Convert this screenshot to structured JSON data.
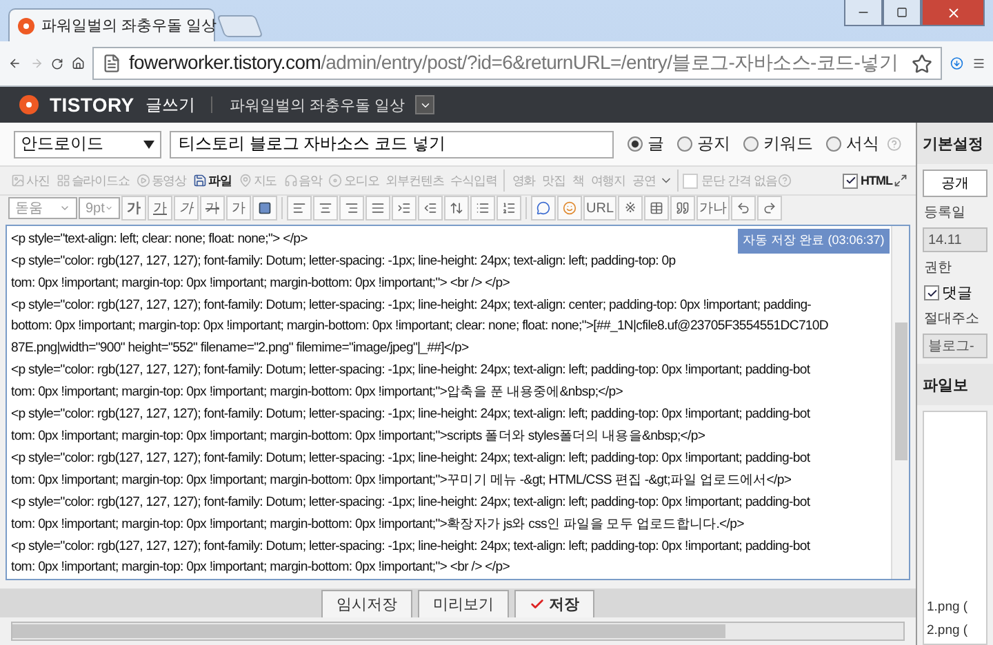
{
  "browser": {
    "tab": {
      "title": "파워일벌의 좌충우돌 일상"
    },
    "url": {
      "host": "fowerworker.tistory.com",
      "path": "/admin/entry/post/?id=6&returnURL=/entry/블로그-자바소스-코드-넣기"
    }
  },
  "header": {
    "logo": "TISTORY",
    "section": "글쓰기",
    "blog": "파워일벌의 좌충우돌 일상"
  },
  "post": {
    "category": "안드로이드",
    "title": "티스토리 블로그 자바소스 코드 넣기",
    "types": [
      {
        "label": "글",
        "selected": true
      },
      {
        "label": "공지",
        "selected": false
      },
      {
        "label": "키워드",
        "selected": false
      },
      {
        "label": "서식",
        "selected": false
      }
    ]
  },
  "media_toolbar": [
    {
      "label": "사진",
      "disabled": true
    },
    {
      "label": "슬라이드쇼",
      "disabled": true
    },
    {
      "label": "동영상",
      "disabled": true
    },
    {
      "label": "파일",
      "disabled": false
    },
    {
      "label": "지도",
      "disabled": true
    },
    {
      "label": "음악",
      "disabled": true
    },
    {
      "label": "오디오",
      "disabled": true
    },
    {
      "label": "외부컨텐츠",
      "disabled": true
    },
    {
      "label": "수식입력",
      "disabled": true
    }
  ],
  "topic_toolbar": [
    "영화",
    "맛집",
    "책",
    "여행지",
    "공연"
  ],
  "options": [
    {
      "label": "문단 간격 없음",
      "checked": false,
      "disabled": true
    },
    {
      "label": "HTML",
      "checked": true,
      "disabled": false
    }
  ],
  "format_toolbar": {
    "font": "돋움",
    "size": "9pt",
    "glyphs": [
      "가",
      "가",
      "가",
      "가",
      "가"
    ],
    "link": "URL",
    "mark": "※",
    "ruby": "가나"
  },
  "editor": {
    "toast": "자동 저장 완료 (03:06:37)",
    "lines": [
      "<p style=\"text-align: left; clear: none; float: none;\"> </p>",
      "<p style=\"color: rgb(127, 127, 127); font-family: Dotum; letter-spacing: -1px; line-height: 24px; text-align: left; padding-top: 0p",
      "tom: 0px !important; margin-top: 0px !important; margin-bottom: 0px !important;\"> <br /> </p>",
      "<p style=\"color: rgb(127, 127, 127); font-family: Dotum; letter-spacing: -1px; line-height: 24px; text-align: center; padding-top: 0px !important; padding-",
      "bottom: 0px !important; margin-top: 0px !important; margin-bottom: 0px !important; clear: none; float: none;\">[##_1N|cfile8.uf@23705F3554551DC710D",
      "87E.png|width=\"900\" height=\"552\" filename=\"2.png\" filemime=\"image/jpeg\"|_##]</p>",
      "<p style=\"color: rgb(127, 127, 127); font-family: Dotum; letter-spacing: -1px; line-height: 24px; text-align: left; padding-top: 0px !important; padding-bot",
      "tom: 0px !important; margin-top: 0px !important; margin-bottom: 0px !important;\">압축을 푼 내용중에&nbsp;</p>",
      "<p style=\"color: rgb(127, 127, 127); font-family: Dotum; letter-spacing: -1px; line-height: 24px; text-align: left; padding-top: 0px !important; padding-bot",
      "tom: 0px !important; margin-top: 0px !important; margin-bottom: 0px !important;\">scripts 폴더와 styles폴더의 내용을&nbsp;</p>",
      "<p style=\"color: rgb(127, 127, 127); font-family: Dotum; letter-spacing: -1px; line-height: 24px; text-align: left; padding-top: 0px !important; padding-bot",
      "tom: 0px !important; margin-top: 0px !important; margin-bottom: 0px !important;\">꾸미기 메뉴 -&gt; HTML/CSS 편집 -&gt;파일 업로드에서</p>",
      "<p style=\"color: rgb(127, 127, 127); font-family: Dotum; letter-spacing: -1px; line-height: 24px; text-align: left; padding-top: 0px !important; padding-bot",
      "tom: 0px !important; margin-top: 0px !important; margin-bottom: 0px !important;\">확장자가 js와 css인 파일을 모두 업로드합니다.</p>",
      "<p style=\"color: rgb(127, 127, 127); font-family: Dotum; letter-spacing: -1px; line-height: 24px; text-align: left; padding-top: 0px !important; padding-bot",
      "tom: 0px !important; margin-top: 0px !important; margin-bottom: 0px !important;\"> <br /> </p>"
    ]
  },
  "actions": [
    {
      "label": "임시저장",
      "kind": "plain"
    },
    {
      "label": "미리보기",
      "kind": "plain"
    },
    {
      "label": "저장",
      "kind": "save"
    }
  ],
  "sidebar": {
    "title": "기본설정",
    "visibility": "공개",
    "date_label": "등록일",
    "date": "14.11",
    "permission_label": "권한",
    "comment": {
      "label": "댓글",
      "checked": true
    },
    "address_label": "절대주소",
    "address": "블로그-",
    "files_title": "파일보",
    "files": [
      "1.png (",
      "2.png ("
    ]
  }
}
